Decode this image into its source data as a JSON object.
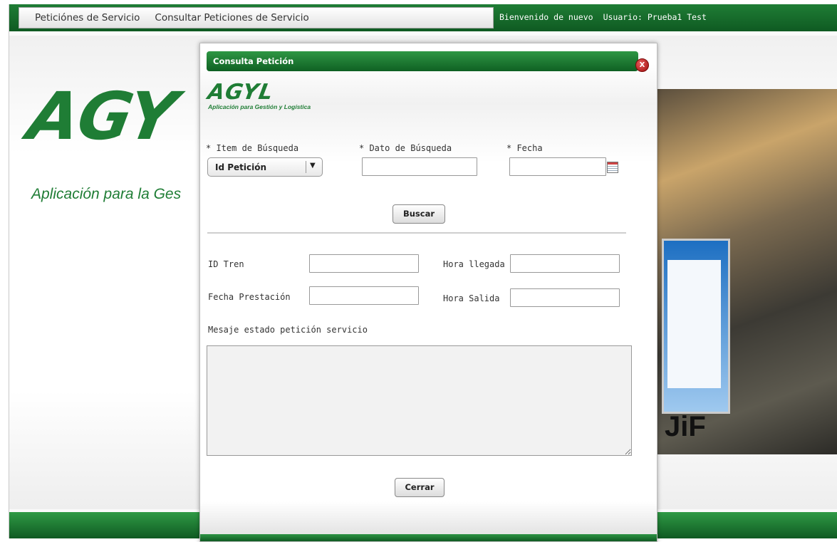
{
  "menu": {
    "items": [
      "Peticiónes de Servicio",
      "Consultar Peticiones de Servicio"
    ]
  },
  "user": {
    "welcome": "Bienvenido de nuevo",
    "user_label": "Usuario: Prueba1 Test"
  },
  "background": {
    "brand": "AGY",
    "subtitle": "Aplicación para la Ges",
    "photo_text": "JiF"
  },
  "dialog": {
    "title": "Consulta Petición",
    "close_label": "X",
    "logo_text": "AGYL",
    "logo_subtitle": "Aplicación para Gestión y Logística",
    "search": {
      "item_label": "* Item de Búsqueda",
      "item_selected": "Id Petición",
      "data_label": "* Dato de Búsqueda",
      "data_value": "",
      "date_label": "* Fecha",
      "date_value": "",
      "search_button": "Buscar"
    },
    "details": {
      "train_id_label": "ID Tren",
      "train_id_value": "",
      "arrival_label": "Hora llegada",
      "arrival_value": "",
      "service_date_label": "Fecha Prestación",
      "service_date_value": "",
      "departure_label": "Hora Salida",
      "departure_value": "",
      "message_label": "Mesaje estado petición servicio",
      "message_value": ""
    },
    "close_button": "Cerrar"
  },
  "colors": {
    "brand_green": "#1f7d35",
    "header_green_dark": "#0f5a22",
    "close_red": "#a10d0d"
  }
}
